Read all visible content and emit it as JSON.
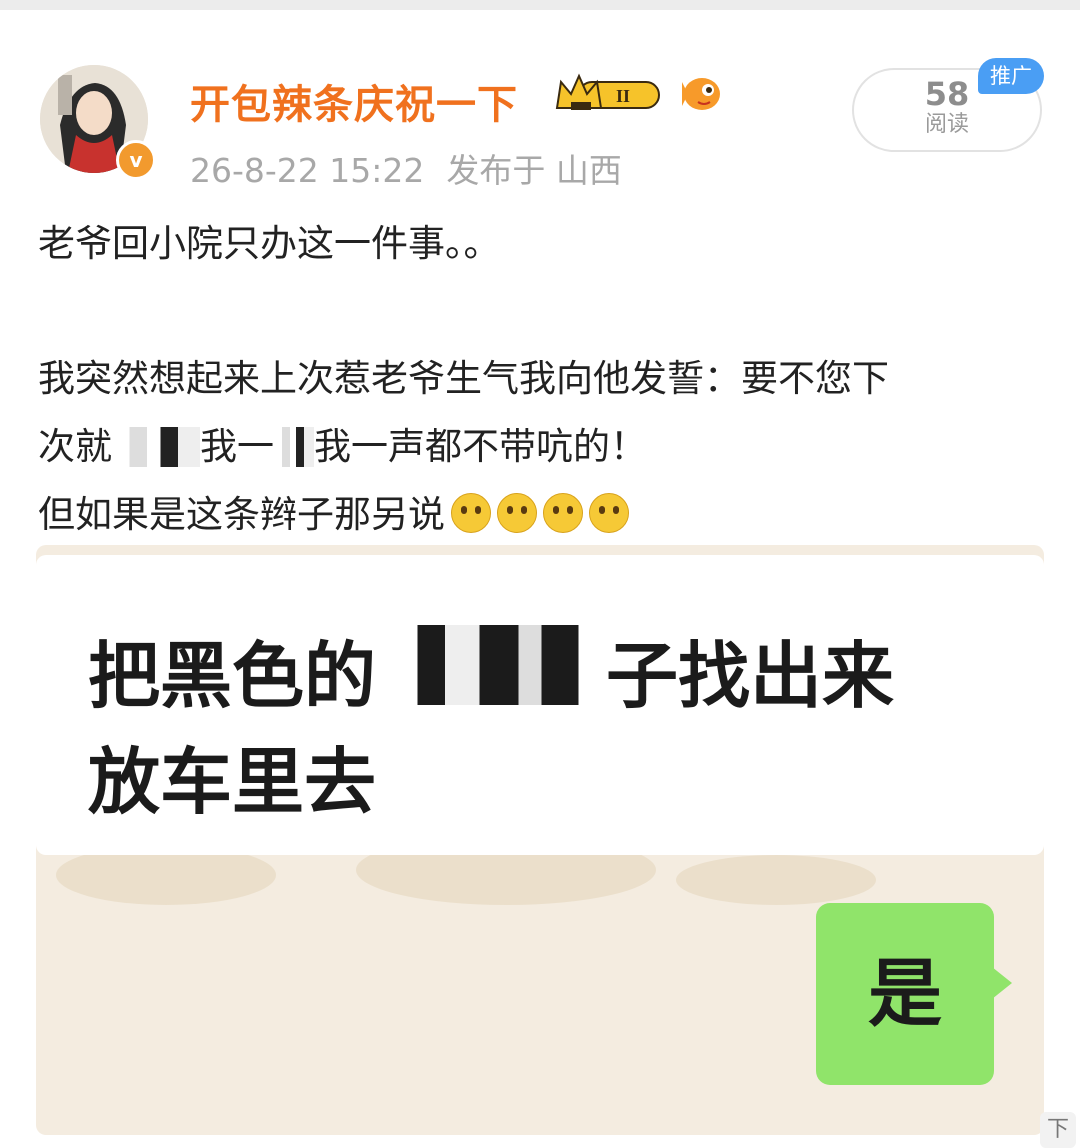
{
  "post": {
    "author": "开包辣条庆祝一下",
    "level": "II",
    "time": "26-8-22 15:22",
    "location": "发布于 山西",
    "reads_count": "58",
    "reads_label": "阅读",
    "promo_badge": "推广",
    "line1": "老爷回小院只办这一件事。。",
    "line2": "我突然想起来上次惹老爷生气我向他发誓：要不您下",
    "line3_a": "次就",
    "line3_b": "我一",
    "line3_c": "我一声都不带吭的！",
    "line4": "但如果是这条辫子那另说"
  },
  "image": {
    "line1_a": "把黑色的",
    "line1_b": "子找出来",
    "line2": "放车里去",
    "reply": "是"
  },
  "footer": {
    "more_label": "下"
  },
  "colors": {
    "author": "#f0711e",
    "promo": "#4a9ef4",
    "bubble": "#90e46a"
  }
}
